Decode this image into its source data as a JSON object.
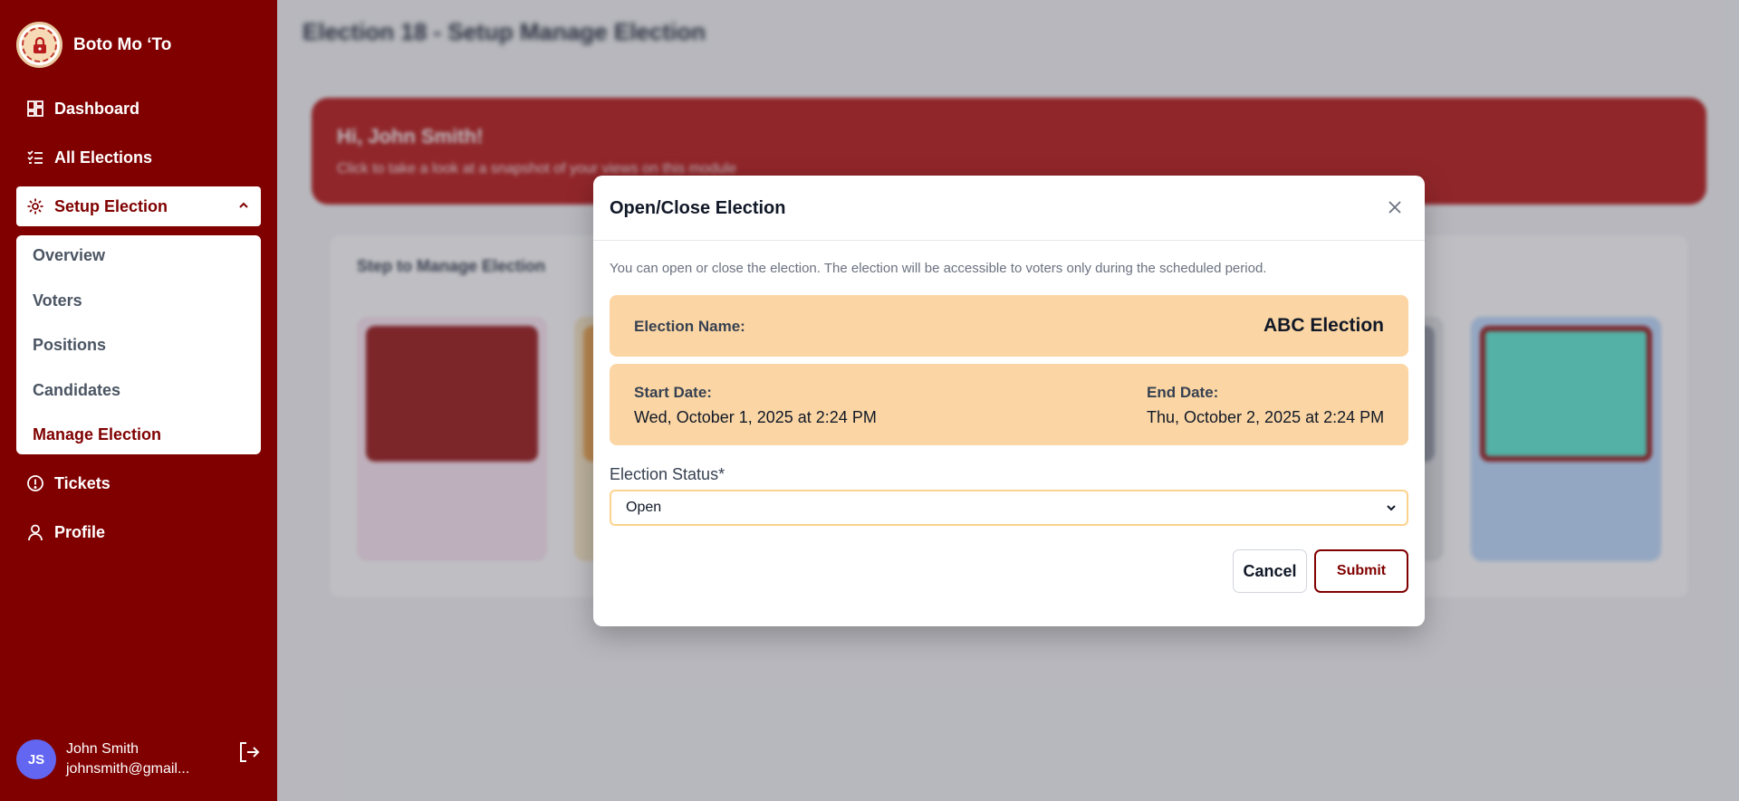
{
  "app": {
    "name": "Boto Mo ‘To"
  },
  "sidebar": {
    "nav": [
      {
        "label": "Dashboard"
      },
      {
        "label": "All Elections"
      },
      {
        "label": "Setup Election"
      },
      {
        "label": "Tickets"
      },
      {
        "label": "Profile"
      }
    ],
    "submenu": [
      {
        "label": "Overview"
      },
      {
        "label": "Voters"
      },
      {
        "label": "Positions"
      },
      {
        "label": "Candidates"
      },
      {
        "label": "Manage Election"
      }
    ]
  },
  "user": {
    "initials": "JS",
    "name": "John Smith",
    "email": "johnsmith@gmail..."
  },
  "background": {
    "title": "Election 18 - Setup Manage Election",
    "banner_title": "Hi, John Smith!",
    "banner_text": "Click to take a look at a snapshot of your views on this module",
    "steps_title": "Step to Manage Election"
  },
  "modal": {
    "title": "Open/Close Election",
    "description": "You can open or close the election. The election will be accessible to voters only during the scheduled period.",
    "election_name_label": "Election Name:",
    "election_name": "ABC Election",
    "start_label": "Start Date:",
    "start_value": "Wed, October 1, 2025 at 2:24 PM",
    "end_label": "End Date:",
    "end_value": "Thu, October 2, 2025 at 2:24 PM",
    "status_label": "Election Status*",
    "status_value": "Open",
    "cancel_label": "Cancel",
    "submit_label": "Submit"
  },
  "colors": {
    "brand": "#800000",
    "info_box": "#fbd6a4",
    "avatar": "#6366f1"
  },
  "icons": [
    "lock-icon",
    "dashboard-icon",
    "list-check-icon",
    "gear-icon",
    "chevron-up-icon",
    "alert-circle-icon",
    "user-icon",
    "logout-icon",
    "close-icon",
    "chevron-down-icon"
  ]
}
